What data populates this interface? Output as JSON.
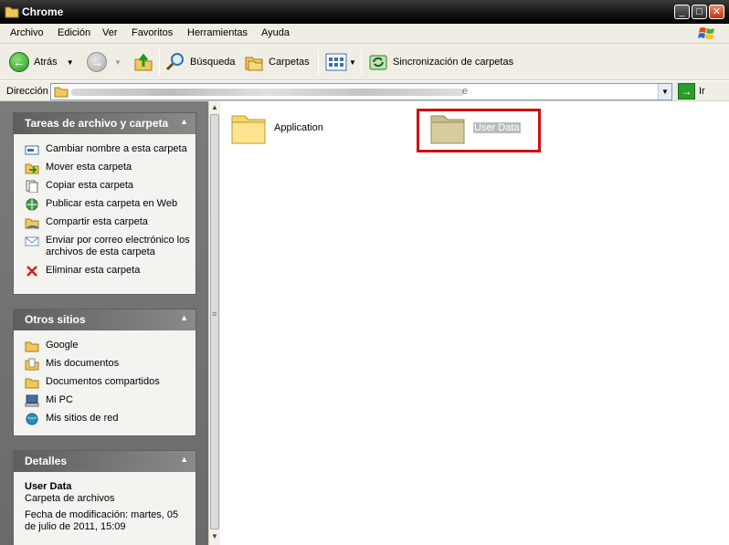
{
  "window": {
    "title": "Chrome"
  },
  "menu": [
    "Archivo",
    "Edición",
    "Ver",
    "Favoritos",
    "Herramientas",
    "Ayuda"
  ],
  "toolbar": {
    "back": "Atrás",
    "search": "Búsqueda",
    "folders": "Carpetas",
    "sync": "Sincronización de carpetas"
  },
  "address": {
    "label": "Dirección",
    "value_suffix": "e",
    "go": "Ir"
  },
  "tasks_panel": {
    "title": "Tareas de archivo y carpeta",
    "items": [
      {
        "label": "Cambiar nombre a esta carpeta",
        "icon": "rename-icon"
      },
      {
        "label": "Mover esta carpeta",
        "icon": "move-icon"
      },
      {
        "label": "Copiar esta carpeta",
        "icon": "copy-icon"
      },
      {
        "label": "Publicar esta carpeta en Web",
        "icon": "publish-web-icon"
      },
      {
        "label": "Compartir esta carpeta",
        "icon": "share-icon"
      },
      {
        "label": "Enviar por correo electrónico los archivos de esta carpeta",
        "icon": "email-icon"
      },
      {
        "label": "Eliminar esta carpeta",
        "icon": "delete-icon"
      }
    ]
  },
  "places_panel": {
    "title": "Otros sitios",
    "items": [
      {
        "label": "Google",
        "icon": "folder-icon"
      },
      {
        "label": "Mis documentos",
        "icon": "my-documents-icon"
      },
      {
        "label": "Documentos compartidos",
        "icon": "folder-icon"
      },
      {
        "label": "Mi PC",
        "icon": "my-computer-icon"
      },
      {
        "label": "Mis sitios de red",
        "icon": "network-icon"
      }
    ]
  },
  "details_panel": {
    "title": "Detalles",
    "name": "User Data",
    "type": "Carpeta de archivos",
    "modified": "Fecha de modificación: martes, 05 de julio de 2011, 15:09"
  },
  "files": [
    {
      "name": "Application",
      "selected": false
    },
    {
      "name": "User Data",
      "selected": true
    }
  ],
  "colors": {
    "selection_highlight": "#d01010",
    "back_button": "#1f9a1f"
  }
}
